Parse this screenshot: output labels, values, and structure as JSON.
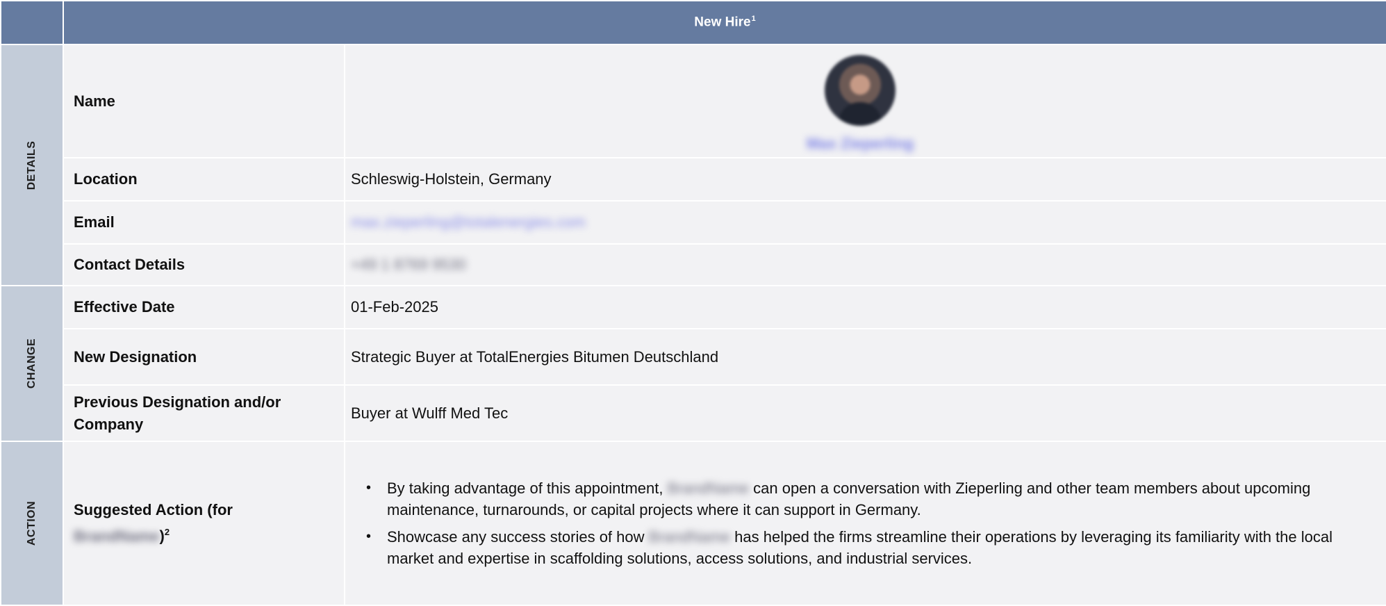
{
  "header": {
    "title": "New Hire",
    "footnote": "1"
  },
  "sections": {
    "details": "DETAILS",
    "change": "CHANGE",
    "action": "ACTION"
  },
  "details": {
    "name_label": "Name",
    "profile_name": "Max Zieperling",
    "location_label": "Location",
    "location_value": "Schleswig-Holstein, Germany",
    "email_label": "Email",
    "email_value": "max.zieperling@totalenergies.com",
    "contact_label": "Contact Details",
    "contact_value": "+49 1 8769 9530"
  },
  "change": {
    "effective_date_label": "Effective Date",
    "effective_date_value": "01-Feb-2025",
    "new_designation_label": "New Designation",
    "new_designation_value": "Strategic Buyer at TotalEnergies Bitumen Deutschland",
    "previous_designation_label_line1": "Previous Designation and/or",
    "previous_designation_label_line2": "Company",
    "previous_designation_value": "Buyer at Wulff Med Tec"
  },
  "action": {
    "suggested_label_line1": "Suggested Action (for",
    "suggested_label_redacted": "BrandName",
    "suggested_label_close": ")",
    "suggested_label_footnote": "2",
    "bullet1_pre": "By taking advantage of this appointment,",
    "bullet1_redacted": "BrandName",
    "bullet1_post": "can open a conversation with Zieperling and other team members about upcoming maintenance, turnarounds, or capital projects where it can support in Germany.",
    "bullet2_pre": "Showcase any success stories of how",
    "bullet2_redacted": "BrandName",
    "bullet2_post": "has helped the firms streamline their operations by leveraging its familiarity with the local market and expertise in scaffolding solutions, access solutions, and industrial services."
  },
  "colors": {
    "header_bg": "#657ba0",
    "section_bg": "#c3ccd9",
    "cell_bg": "#f2f2f4",
    "link_blur": "#8a8ee8"
  }
}
